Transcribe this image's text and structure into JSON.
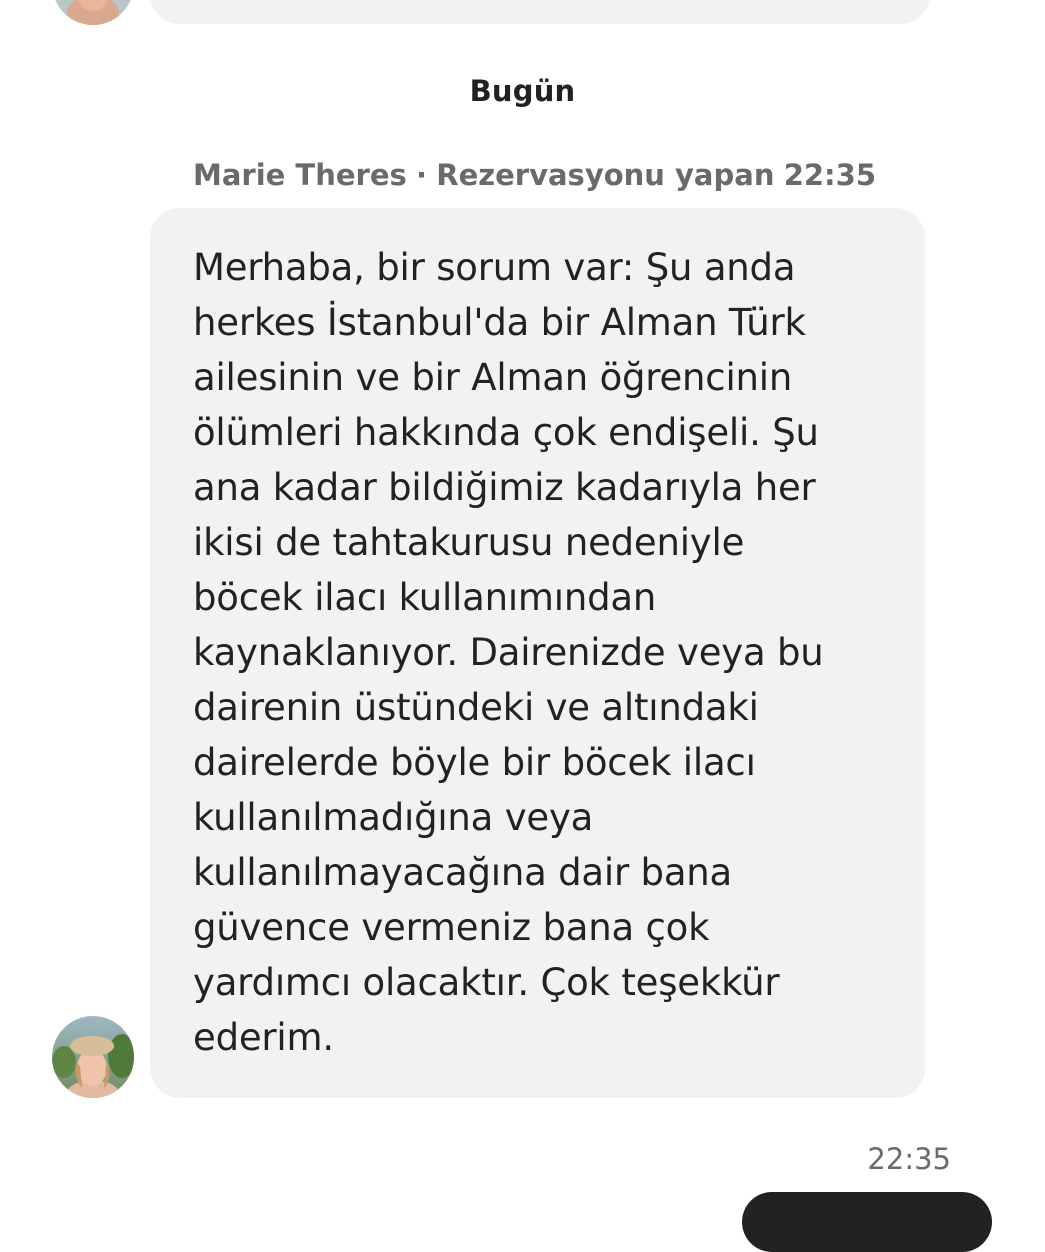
{
  "date_divider": "Bugün",
  "message": {
    "sender_name": "Marie Theres",
    "separator": "·",
    "sender_role": "Rezervasyonu yapan",
    "time": "22:35",
    "text": "Merhaba, bir sorum var: Şu anda\nherkes İstanbul'da bir Alman Türk\nailesinin ve bir Alman öğrencinin\nölümleri hakkında çok endişeli. Şu\nana kadar bildiğimiz kadarıyla her\nikisi de tahtakurusu nedeniyle\nböcek ilacı kullanımından\nkaynaklanıyor. Dairenizde veya bu\ndairenin üstündeki ve altındaki\ndairelerde böyle bir böcek ilacı\nkullanılmadığına veya\nkullanılmayacağına dair bana\ngüvence vermeniz bana çok\nyardımcı olacaktır. Çok teşekkür\nederim."
  },
  "outgoing": {
    "time": "22:35"
  },
  "colors": {
    "bubble_incoming": "#f2f2f2",
    "bubble_outgoing": "#222222",
    "meta_text": "#6a6a6a",
    "body_text": "#222222"
  },
  "icons": {
    "sender_avatar": "user-avatar-photo"
  }
}
